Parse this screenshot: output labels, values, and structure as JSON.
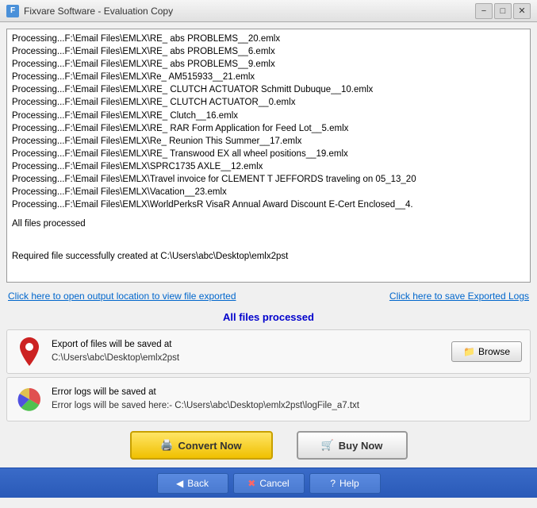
{
  "titleBar": {
    "title": "Fixvare Software - Evaluation Copy",
    "icon": "F",
    "minimize": "−",
    "maximize": "□",
    "close": "✕"
  },
  "logOutput": {
    "lines": [
      "Processing...F:\\Email Files\\EMLX\\RE_ abs PROBLEMS__20.emlx",
      "Processing...F:\\Email Files\\EMLX\\RE_ abs PROBLEMS__6.emlx",
      "Processing...F:\\Email Files\\EMLX\\RE_ abs PROBLEMS__9.emlx",
      "Processing...F:\\Email Files\\EMLX\\Re_ AM515933__21.emlx",
      "Processing...F:\\Email Files\\EMLX\\RE_ CLUTCH ACTUATOR Schmitt Dubuque__10.emlx",
      "Processing...F:\\Email Files\\EMLX\\RE_ CLUTCH ACTUATOR__0.emlx",
      "Processing...F:\\Email Files\\EMLX\\RE_ Clutch__16.emlx",
      "Processing...F:\\Email Files\\EMLX\\RE_ RAR Form Application for Feed Lot__5.emlx",
      "Processing...F:\\Email Files\\EMLX\\Re_ Reunion This Summer__17.emlx",
      "Processing...F:\\Email Files\\EMLX\\RE_ Transwood EX all wheel positions__19.emlx",
      "Processing...F:\\Email Files\\EMLX\\SPRC1735 AXLE__12.emlx",
      "Processing...F:\\Email Files\\EMLX\\Travel invoice for CLEMENT T JEFFORDS traveling on 05_13_20",
      "Processing...F:\\Email Files\\EMLX\\Vacation__23.emlx",
      "Processing...F:\\Email Files\\EMLX\\WorldPerksR VisaR Annual Award Discount E-Cert Enclosed__4."
    ],
    "allFilesProcessed": "All files processed",
    "successMsg": "Required file successfully created at C:\\Users\\abc\\Desktop\\emlx2pst"
  },
  "links": {
    "viewFile": "Click here to open output location to view file exported",
    "saveLogs": "Click here to save Exported Logs"
  },
  "statusMessage": "All files processed",
  "exportPanel": {
    "label": "Export of files will be saved at",
    "path": "C:\\Users\\abc\\Desktop\\emlx2pst",
    "browseLabel": "Browse",
    "browseIcon": "📁"
  },
  "errorPanel": {
    "label": "Error logs will be saved at",
    "path": "Error logs will be saved here:- C:\\Users\\abc\\Desktop\\emlx2pst\\logFile_a7.txt"
  },
  "buttons": {
    "convert": "Convert Now",
    "convertIcon": "🖨",
    "buy": "Buy Now",
    "buyIcon": "🛒"
  },
  "navigation": {
    "back": "Back",
    "backIcon": "◀",
    "cancel": "Cancel",
    "cancelIcon": "✖",
    "help": "Help",
    "helpIcon": "?"
  }
}
